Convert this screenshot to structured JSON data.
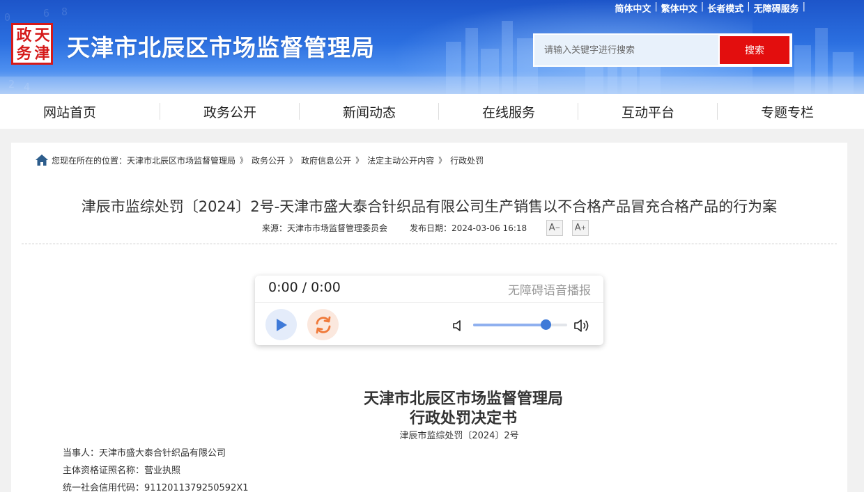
{
  "header": {
    "logo_chars": [
      "政",
      "天",
      "务",
      "津"
    ],
    "site_title": "天津市北辰区市场监督管理局",
    "top_links": [
      "简体中文",
      "繁体中文",
      "长者模式",
      "无障碍服务"
    ],
    "search": {
      "placeholder": "请输入关键字进行搜索",
      "button": "搜索"
    },
    "banner_digits": [
      "6",
      "8",
      "0",
      "2",
      "4"
    ]
  },
  "nav": {
    "items": [
      "网站首页",
      "政务公开",
      "新闻动态",
      "在线服务",
      "互动平台",
      "专题专栏"
    ]
  },
  "breadcrumb": {
    "prefix": "您现在所在的位置：",
    "items": [
      "天津市北辰区市场监督管理局",
      "政务公开",
      "政府信息公开",
      "法定主动公开内容",
      "行政处罚"
    ],
    "separator": "》"
  },
  "article": {
    "title": "津辰市监综处罚〔2024〕2号-天津市盛大泰合针织品有限公司生产销售以不合格产品冒充合格产品的行为案",
    "source": "来源：天津市市场监督管理委员会",
    "date": "发布日期：2024-03-06 16:18",
    "font_smaller": "A",
    "font_larger": "A"
  },
  "player": {
    "time": "0:00 / 0:00",
    "label": "无障碍语音播报",
    "volume": 0.77,
    "icons": [
      "play-icon",
      "loop-icon",
      "volume-low-icon",
      "volume-high-icon"
    ]
  },
  "document": {
    "org": "天津市北辰区市场监督管理局",
    "type": "行政处罚决定书",
    "number": "津辰市监综处罚〔2024〕2号",
    "lines": [
      "当事人：天津市盛大泰合针织品有限公司",
      "主体资格证照名称：营业执照",
      "统一社会信用代码：9112011379250592X1"
    ]
  },
  "colors": {
    "banner_blue": "#2b6fe0",
    "search_red": "#e30e0e",
    "logo_red": "#d51a1a",
    "play_blue": "#3f7ad8",
    "loop_orange": "#f07a3a"
  }
}
